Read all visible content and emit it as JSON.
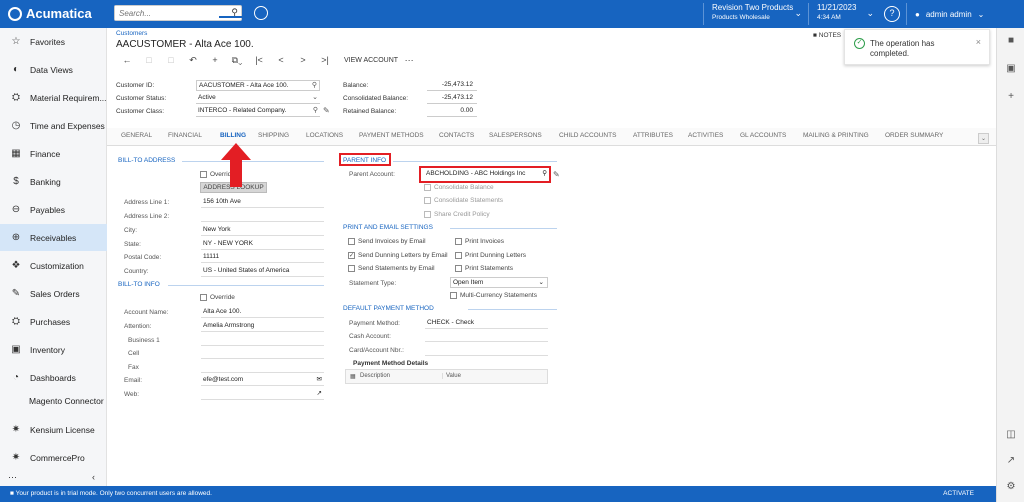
{
  "app": {
    "logo": "Acumatica"
  },
  "search": {
    "placeholder": "Search..."
  },
  "tenant": {
    "company": "Revision Two Products",
    "branch": "Products Wholesale"
  },
  "datetime": {
    "date": "11/21/2023",
    "time": "4:34 AM"
  },
  "user": {
    "name": "admin admin"
  },
  "sidebar": {
    "items": [
      {
        "label": "Favorites",
        "icon": "star-icon"
      },
      {
        "label": "Data Views",
        "icon": "chart-icon"
      },
      {
        "label": "Material Requirem...",
        "icon": "cart-icon"
      },
      {
        "label": "Time and Expenses",
        "icon": "clock-icon"
      },
      {
        "label": "Finance",
        "icon": "calculator-icon"
      },
      {
        "label": "Banking",
        "icon": "dollar-icon"
      },
      {
        "label": "Payables",
        "icon": "minus-circle-icon"
      },
      {
        "label": "Receivables",
        "icon": "plus-circle-icon"
      },
      {
        "label": "Customization",
        "icon": "puzzle-icon"
      },
      {
        "label": "Sales Orders",
        "icon": "edit-icon"
      },
      {
        "label": "Purchases",
        "icon": "cart-icon"
      },
      {
        "label": "Inventory",
        "icon": "truck-icon"
      },
      {
        "label": "Dashboards",
        "icon": "gauge-icon"
      },
      {
        "label": "Magento Connector",
        "icon": ""
      },
      {
        "label": "Kensium License",
        "icon": "network-icon"
      },
      {
        "label": "CommercePro",
        "icon": "network-icon"
      }
    ]
  },
  "status_bar": {
    "message": "Your product is in trial mode. Only two concurrent users are allowed.",
    "action": "ACTIVATE"
  },
  "page": {
    "breadcrumb": "Customers",
    "title": "AACUSTOMER - Alta Ace 100.",
    "notes": "NOTES",
    "toolbar_view_account": "VIEW ACCOUNT"
  },
  "toast": {
    "message": "The operation has completed."
  },
  "summary": {
    "customer_id_label": "Customer ID:",
    "customer_id": "AACUSTOMER - Alta Ace 100.",
    "customer_status_label": "Customer Status:",
    "customer_status": "Active",
    "customer_class_label": "Customer Class:",
    "customer_class": "INTERCO - Related Company.",
    "balance_label": "Balance:",
    "balance": "-25,473.12",
    "consolidated_balance_label": "Consolidated Balance:",
    "consolidated_balance": "-25,473.12",
    "retained_balance_label": "Retained Balance:",
    "retained_balance": "0.00"
  },
  "tabs": [
    "GENERAL",
    "FINANCIAL",
    "BILLING",
    "SHIPPING",
    "LOCATIONS",
    "PAYMENT METHODS",
    "CONTACTS",
    "SALESPERSONS",
    "CHILD ACCOUNTS",
    "ATTRIBUTES",
    "ACTIVITIES",
    "GL ACCOUNTS",
    "MAILING & PRINTING",
    "ORDER SUMMARY"
  ],
  "bill_to_address": {
    "heading": "BILL-TO ADDRESS",
    "override": "Override",
    "lookup": "ADDRESS LOOKUP",
    "fields": [
      {
        "label": "Address Line 1:",
        "value": "156 10th Ave"
      },
      {
        "label": "Address Line 2:",
        "value": ""
      },
      {
        "label": "City:",
        "value": "New York"
      },
      {
        "label": "State:",
        "value": "NY - NEW YORK"
      },
      {
        "label": "Postal Code:",
        "value": "11111"
      },
      {
        "label": "Country:",
        "value": "US - United States of America"
      }
    ]
  },
  "bill_to_info": {
    "heading": "BILL-TO INFO",
    "override": "Override",
    "fields": [
      {
        "label": "Account Name:",
        "value": "Alta Ace 100."
      },
      {
        "label": "Attention:",
        "value": "Amelia Armstrong"
      },
      {
        "label": "Business 1",
        "value": ""
      },
      {
        "label": "Cell",
        "value": ""
      },
      {
        "label": "Fax",
        "value": ""
      },
      {
        "label": "Email:",
        "value": "efe@test.com"
      },
      {
        "label": "Web:",
        "value": ""
      }
    ]
  },
  "parent_info": {
    "heading": "PARENT INFO",
    "parent_account_label": "Parent Account:",
    "parent_account": "ABCHOLDING - ABC Holdings Inc",
    "consolidate_balance": "Consolidate Balance",
    "consolidate_statements": "Consolidate Statements",
    "share_credit_policy": "Share Credit Policy"
  },
  "print_email": {
    "heading": "PRINT AND EMAIL SETTINGS",
    "send_invoices": "Send Invoices by Email",
    "print_invoices": "Print Invoices",
    "send_dunning": "Send Dunning Letters by Email",
    "print_dunning": "Print Dunning Letters",
    "send_statements": "Send Statements by Email",
    "print_statements": "Print Statements",
    "statement_type_label": "Statement Type:",
    "statement_type": "Open Item",
    "multi_currency": "Multi-Currency Statements"
  },
  "default_payment": {
    "heading": "DEFAULT PAYMENT METHOD",
    "method_label": "Payment Method:",
    "method": "CHECK - Check",
    "cash_account_label": "Cash Account:",
    "card_label": "Card/Account Nbr.:",
    "details_heading": "Payment Method Details",
    "col_description": "Description",
    "col_value": "Value"
  }
}
